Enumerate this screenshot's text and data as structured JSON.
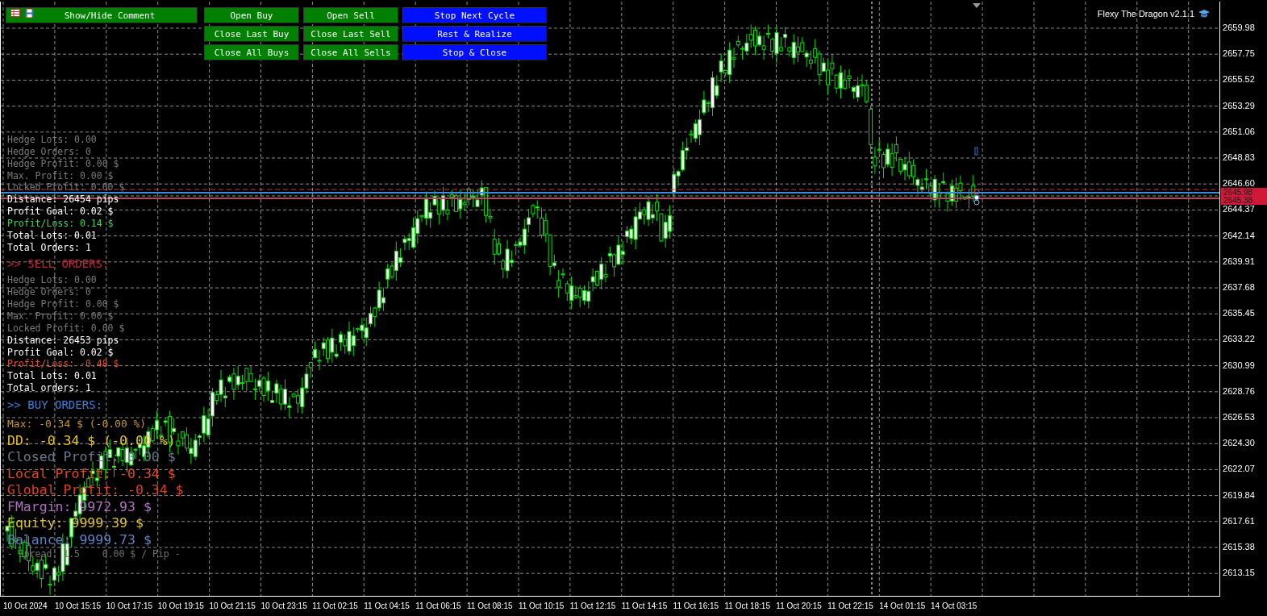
{
  "comment_button": {
    "label": "Show/Hide Comment",
    "kind": "trade"
  },
  "button_grid": [
    {
      "label": "Open Buy",
      "kind": "trade"
    },
    {
      "label": "Open Sell",
      "kind": "trade"
    },
    {
      "label": "Stop Next Cycle",
      "kind": "control"
    },
    {
      "label": "Close Last Buy",
      "kind": "trade"
    },
    {
      "label": "Close Last Sell",
      "kind": "trade"
    },
    {
      "label": "Rest & Realize",
      "kind": "control"
    },
    {
      "label": "Close All Buys",
      "kind": "trade"
    },
    {
      "label": "Close All Sells",
      "kind": "trade"
    },
    {
      "label": "Stop & Close",
      "kind": "control"
    }
  ],
  "indicator_title": "Flexy The Dragon v2.1.1",
  "comment_lines": [
    {
      "text": "Hedge Lots: 0.00",
      "kind": "small",
      "color": "#7a7a7a"
    },
    {
      "text": "Hedge Orders: 0",
      "kind": "small",
      "color": "#7a7a7a"
    },
    {
      "text": "Hedge Profit: 0.00 $",
      "kind": "small",
      "color": "#7a7a7a"
    },
    {
      "text": "Max. Profit: 0.00 $",
      "kind": "small",
      "color": "#7a7a7a"
    },
    {
      "text": "Locked Profit: 0.00 $",
      "kind": "small",
      "color": "#7a7a7a"
    },
    {
      "text": "Distance: 26454 pips",
      "kind": "small",
      "color": "#ffffff"
    },
    {
      "text": "Profit Goal: 0.02 $",
      "kind": "small",
      "color": "#ffffff"
    },
    {
      "text": "Profit/Loss: 0.14 $",
      "kind": "small",
      "color": "#40d060"
    },
    {
      "text": "Total Lots: 0.01",
      "kind": "small",
      "color": "#ffffff"
    },
    {
      "text": "Total Orders: 1",
      "kind": "small",
      "color": "#ffffff"
    },
    {
      "text": ">> SELL ORDERS:",
      "kind": "header",
      "color": "#c02838"
    },
    {
      "text": "Hedge Lots: 0.00",
      "kind": "small",
      "color": "#7a7a7a"
    },
    {
      "text": "Hedge Orders: 0",
      "kind": "small",
      "color": "#7a7a7a"
    },
    {
      "text": "Hedge Profit: 0.00 $",
      "kind": "small",
      "color": "#7a7a7a"
    },
    {
      "text": "Max. Profit: 0.00 $",
      "kind": "small",
      "color": "#7a7a7a"
    },
    {
      "text": "Locked Profit: 0.00 $",
      "kind": "small",
      "color": "#7a7a7a"
    },
    {
      "text": "Distance: 26453 pips",
      "kind": "small",
      "color": "#ffffff"
    },
    {
      "text": "Profit Goal: 0.02 $",
      "kind": "small",
      "color": "#ffffff"
    },
    {
      "text": "Profit/Loss: -0.48 $",
      "kind": "small",
      "color": "#e0502a"
    },
    {
      "text": "Total Lots: 0.01",
      "kind": "small",
      "color": "#ffffff"
    },
    {
      "text": "Total orders: 1",
      "kind": "small",
      "color": "#ffffff"
    },
    {
      "text": ">> BUY ORDERS:",
      "kind": "header",
      "color": "#3f7fd6"
    },
    {
      "text": "Max: -0.34 $ (-0.00 %)",
      "kind": "medium",
      "color": "#c8962a"
    },
    {
      "text": "DD: -0.34 $ (-0.00 %)",
      "kind": "large",
      "color": "#e8c020"
    },
    {
      "text": "Closed Profit: 0.00 $",
      "kind": "large",
      "color": "#6a7a8a"
    },
    {
      "text": "Local Profit: -0.34 $",
      "kind": "large",
      "color": "#e04a1a"
    },
    {
      "text": "Global Profit: -0.34 $",
      "kind": "large",
      "color": "#e0401a"
    },
    {
      "text": "FMargin: 9972.93 $",
      "kind": "large",
      "color": "#b070c0"
    },
    {
      "text": "Equity: 9999.39 $",
      "kind": "large",
      "color": "#d8c030"
    },
    {
      "text": "Balance: 9999.73 $",
      "kind": "large",
      "color": "#6080c0"
    },
    {
      "text": "- Spread: 1.5    0.00 $ / Pip -",
      "kind": "small",
      "color": "#707070"
    }
  ],
  "price_axis": {
    "labels": [
      "2659.98",
      "2657.75",
      "2655.52",
      "2653.29",
      "2651.06",
      "2648.83",
      "2646.60",
      "2644.37",
      "2642.14",
      "2639.91",
      "2637.68",
      "2635.45",
      "2633.22",
      "2630.99",
      "2628.76",
      "2626.53",
      "2624.30",
      "2622.07",
      "2619.84",
      "2617.61",
      "2615.38",
      "2613.15"
    ],
    "bid_tag": "2645.98",
    "ask_tag": "2645.38"
  },
  "time_axis": {
    "labels": [
      "10 Oct 2024",
      "10 Oct 15:15",
      "10 Oct 17:15",
      "10 Oct 19:15",
      "10 Oct 21:15",
      "10 Oct 23:15",
      "11 Oct 02:15",
      "11 Oct 04:15",
      "11 Oct 06:15",
      "11 Oct 08:15",
      "11 Oct 10:15",
      "11 Oct 12:15",
      "11 Oct 14:15",
      "11 Oct 16:15",
      "11 Oct 18:15",
      "11 Oct 20:15",
      "11 Oct 22:15",
      "14 Oct 01:15",
      "14 Oct 03:15"
    ]
  }
}
